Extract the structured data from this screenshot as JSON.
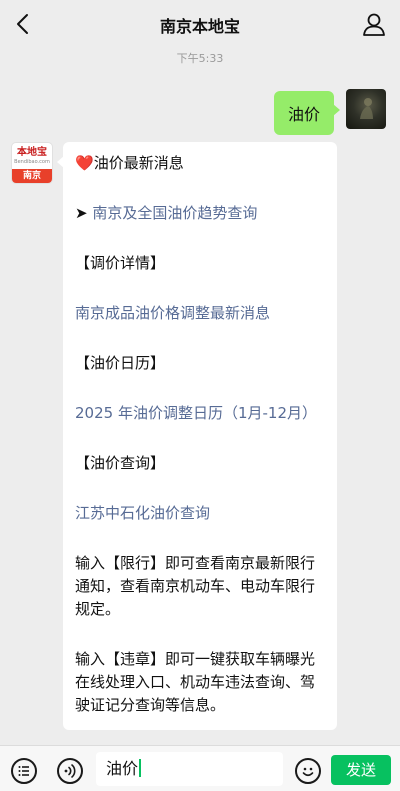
{
  "header": {
    "title": "南京本地宝",
    "back_icon": "chevron-left-icon",
    "profile_icon": "person-icon"
  },
  "chat": {
    "timestamp": "下午5:33",
    "user_message": "油价",
    "bot_avatar": {
      "logo_text": "本地宝",
      "logo_sub": "Bendibao.com",
      "city": "南京"
    },
    "bot_message": {
      "heading": "油价最新消息",
      "trend_link": "南京及全国油价趋势查询",
      "adjust_heading": "【调价详情】",
      "adjust_link": "南京成品油价格调整最新消息",
      "calendar_heading": "【油价日历】",
      "calendar_link": "2025 年油价调整日历（1月-12月）",
      "query_heading": "【油价查询】",
      "query_link": "江苏中石化油价查询",
      "limit_text": "输入【限行】即可查看南京最新限行通知，查看南京机动车、电动车限行规定。",
      "violation_text": "输入【违章】即可一键获取车辆曝光在线处理入口、机动车违法查询、驾驶证记分查询等信息。"
    }
  },
  "composer": {
    "input_value": "油价",
    "send_label": "发送"
  },
  "colors": {
    "user_bubble": "#95ec69",
    "link": "#576b95",
    "send_button": "#07c160"
  }
}
